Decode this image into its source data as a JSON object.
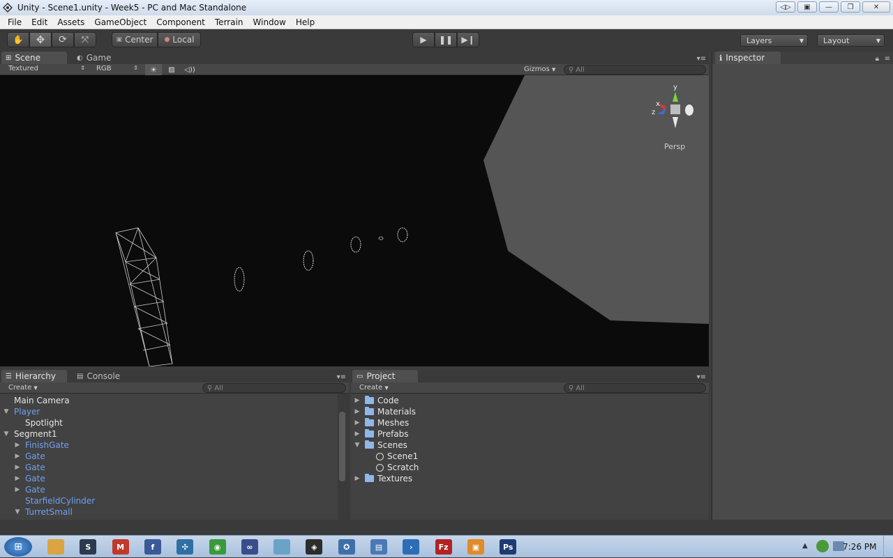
{
  "window": {
    "title": "Unity - Scene1.unity - Week5 - PC and Mac Standalone"
  },
  "menu": [
    "File",
    "Edit",
    "Assets",
    "GameObject",
    "Component",
    "Terrain",
    "Window",
    "Help"
  ],
  "toolbar": {
    "pivot_label": "Center",
    "space_label": "Local",
    "layers_label": "Layers",
    "layout_label": "Layout"
  },
  "scene_panel": {
    "tabs": [
      "Scene",
      "Game"
    ],
    "render_mode": "Textured",
    "color_mode": "RGB",
    "gizmos_label": "Gizmos",
    "search_placeholder": "All",
    "gizmo": {
      "y": "y",
      "x": "x",
      "z": "z",
      "projection": "Persp"
    }
  },
  "inspector": {
    "tab": "Inspector"
  },
  "hierarchy": {
    "tabs": [
      "Hierarchy",
      "Console"
    ],
    "create_label": "Create",
    "search_placeholder": "All",
    "items": [
      {
        "label": "Main Camera",
        "indent": 0,
        "arrow": "",
        "color": "white"
      },
      {
        "label": "Player",
        "indent": 0,
        "arrow": "down",
        "color": "blue"
      },
      {
        "label": "Spotlight",
        "indent": 1,
        "arrow": "",
        "color": "white"
      },
      {
        "label": "Segment1",
        "indent": 0,
        "arrow": "down",
        "color": "white"
      },
      {
        "label": "FinishGate",
        "indent": 1,
        "arrow": "right",
        "color": "blue"
      },
      {
        "label": "Gate",
        "indent": 1,
        "arrow": "right",
        "color": "blue"
      },
      {
        "label": "Gate",
        "indent": 1,
        "arrow": "right",
        "color": "blue"
      },
      {
        "label": "Gate",
        "indent": 1,
        "arrow": "right",
        "color": "blue"
      },
      {
        "label": "Gate",
        "indent": 1,
        "arrow": "right",
        "color": "blue"
      },
      {
        "label": "StarfieldCylinder",
        "indent": 1,
        "arrow": "",
        "color": "blue"
      },
      {
        "label": "TurretSmall",
        "indent": 1,
        "arrow": "down",
        "color": "blue"
      }
    ]
  },
  "project": {
    "tab": "Project",
    "create_label": "Create",
    "search_placeholder": "All",
    "items": [
      {
        "label": "Code",
        "type": "folder",
        "arrow": "right",
        "indent": 0
      },
      {
        "label": "Materials",
        "type": "folder",
        "arrow": "right",
        "indent": 0
      },
      {
        "label": "Meshes",
        "type": "folder",
        "arrow": "right",
        "indent": 0
      },
      {
        "label": "Prefabs",
        "type": "folder",
        "arrow": "right",
        "indent": 0
      },
      {
        "label": "Scenes",
        "type": "folder",
        "arrow": "down",
        "indent": 0
      },
      {
        "label": "Scene1",
        "type": "scene",
        "arrow": "",
        "indent": 1
      },
      {
        "label": "Scratch",
        "type": "scene",
        "arrow": "",
        "indent": 1
      },
      {
        "label": "Textures",
        "type": "folder",
        "arrow": "right",
        "indent": 0
      }
    ]
  },
  "taskbar": {
    "clock": "7:26 PM",
    "icons": [
      {
        "name": "explorer-icon",
        "color": "#d9a441",
        "glyph": ""
      },
      {
        "name": "steam-icon",
        "color": "#2b3a4d",
        "glyph": "S"
      },
      {
        "name": "gmail-icon",
        "color": "#c0392b",
        "glyph": "M"
      },
      {
        "name": "facebook-icon",
        "color": "#3b5998",
        "glyph": "f"
      },
      {
        "name": "network-icon",
        "color": "#2f6fa3",
        "glyph": "✣"
      },
      {
        "name": "chrome-icon",
        "color": "#3a9a3a",
        "glyph": "◉"
      },
      {
        "name": "infinity-icon",
        "color": "#3a4d8a",
        "glyph": "∞"
      },
      {
        "name": "notepad-icon",
        "color": "#6aa3c6",
        "glyph": ""
      },
      {
        "name": "unity-icon",
        "color": "#2d2d2d",
        "glyph": "◈"
      },
      {
        "name": "settings-icon",
        "color": "#3f6fa8",
        "glyph": "✪"
      },
      {
        "name": "folders-icon",
        "color": "#4b79b6",
        "glyph": "▤"
      },
      {
        "name": "terminal-icon",
        "color": "#2d6db5",
        "glyph": "›"
      },
      {
        "name": "filezilla-icon",
        "color": "#b22222",
        "glyph": "Fz"
      },
      {
        "name": "archive-icon",
        "color": "#e08a2a",
        "glyph": "▣"
      },
      {
        "name": "photoshop-icon",
        "color": "#1e3a72",
        "glyph": "Ps"
      }
    ]
  }
}
